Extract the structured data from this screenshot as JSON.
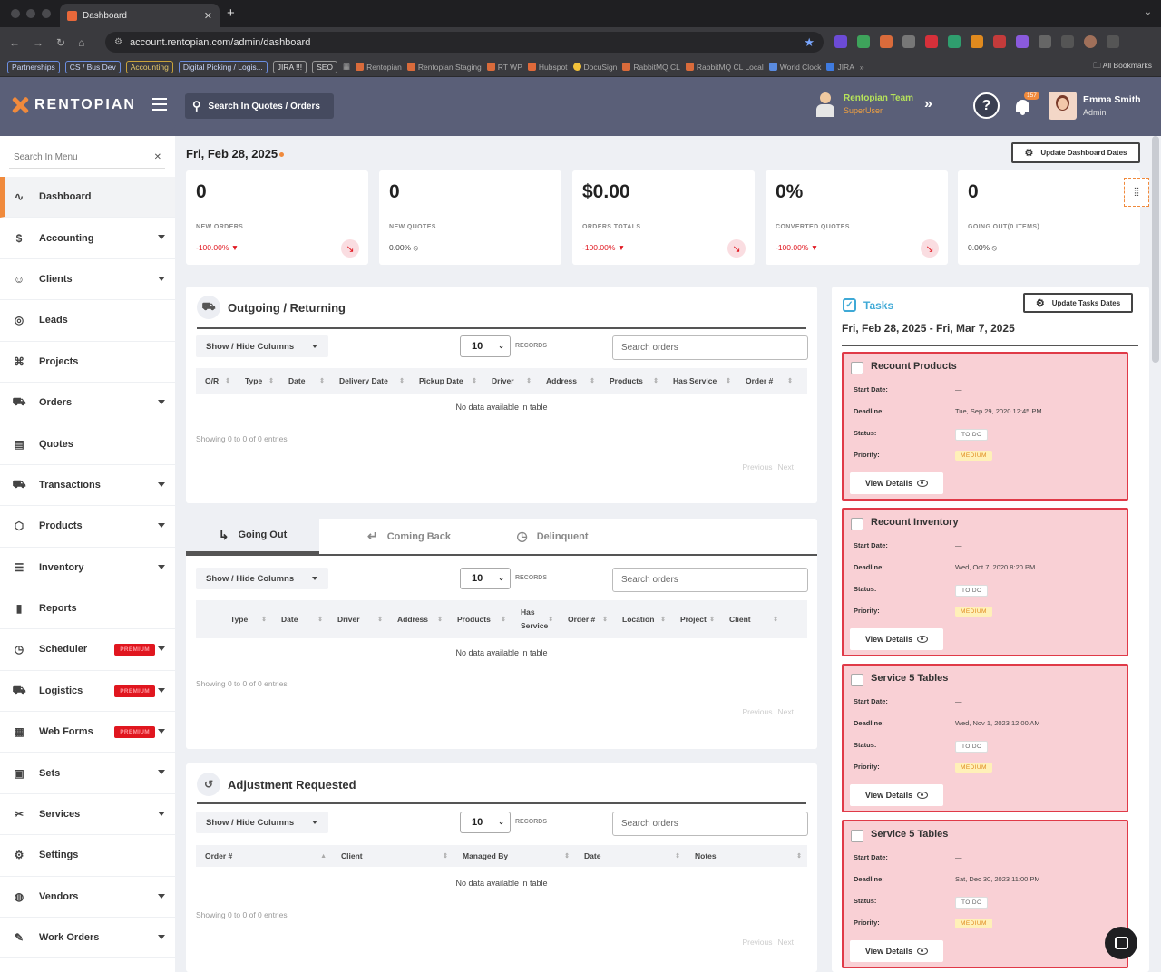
{
  "browser": {
    "tab_title": "Dashboard",
    "url": "account.rentopian.com/admin/dashboard",
    "bookmarks_chips": [
      "Partnerships",
      "CS / Bus Dev",
      "Accounting",
      "Digital Picking / Logis...",
      "JIRA !!!",
      "SEO"
    ],
    "bookmarks_links": [
      "Rentopian",
      "Rentopian Staging",
      "RT WP",
      "Hubspot",
      "DocuSign",
      "RabbitMQ CL",
      "RabbitMQ CL Local",
      "World Clock",
      "JIRA"
    ],
    "all_bookmarks": "All Bookmarks"
  },
  "header": {
    "logo": "RENTOPIAN",
    "search_label": "Search In Quotes / Orders",
    "team_name": "Rentopian Team",
    "team_role": "SuperUser",
    "help": "?",
    "notif_count": "157",
    "user_name": "Emma Smith",
    "user_role": "Admin"
  },
  "sidebar": {
    "search_placeholder": "Search In Menu",
    "premium_label": "PREMIUM",
    "items": [
      {
        "label": "Dashboard",
        "icon": "pulse-icon",
        "glyph": "∿"
      },
      {
        "label": "Accounting",
        "icon": "dollar-icon",
        "glyph": "$"
      },
      {
        "label": "Clients",
        "icon": "users-icon",
        "glyph": "☺"
      },
      {
        "label": "Leads",
        "icon": "target-icon",
        "glyph": "◎"
      },
      {
        "label": "Projects",
        "icon": "command-icon",
        "glyph": "⌘"
      },
      {
        "label": "Orders",
        "icon": "cart-icon",
        "glyph": "⛟"
      },
      {
        "label": "Quotes",
        "icon": "document-icon",
        "glyph": "▤"
      },
      {
        "label": "Transactions",
        "icon": "cart-icon",
        "glyph": "⛟"
      },
      {
        "label": "Products",
        "icon": "box-icon",
        "glyph": "⬡"
      },
      {
        "label": "Inventory",
        "icon": "database-icon",
        "glyph": "☰"
      },
      {
        "label": "Reports",
        "icon": "bar-chart-icon",
        "glyph": "▮"
      },
      {
        "label": "Scheduler",
        "icon": "clock-icon",
        "glyph": "◷"
      },
      {
        "label": "Logistics",
        "icon": "truck-icon",
        "glyph": "⛟"
      },
      {
        "label": "Web Forms",
        "icon": "table-icon",
        "glyph": "▦"
      },
      {
        "label": "Sets",
        "icon": "sets-icon",
        "glyph": "▣"
      },
      {
        "label": "Services",
        "icon": "tools-icon",
        "glyph": "✂"
      },
      {
        "label": "Settings",
        "icon": "gear-icon",
        "glyph": "⚙"
      },
      {
        "label": "Vendors",
        "icon": "globe-icon",
        "glyph": "◍"
      },
      {
        "label": "Work Orders",
        "icon": "wrench-icon",
        "glyph": "✎"
      }
    ]
  },
  "main": {
    "date": "Fri, Feb 28, 2025",
    "update_dates_btn": "Update Dashboard Dates",
    "stats": [
      {
        "value": "0",
        "label": "NEW ORDERS",
        "change": "-100.00%",
        "dir": "down"
      },
      {
        "value": "0",
        "label": "NEW QUOTES",
        "change": "0.00%",
        "dir": "none"
      },
      {
        "value": "$0.00",
        "label": "ORDERS TOTALS",
        "change": "-100.00%",
        "dir": "down"
      },
      {
        "value": "0%",
        "label": "CONVERTED QUOTES",
        "change": "-100.00%",
        "dir": "down"
      },
      {
        "value": "0",
        "label": "GOING OUT(0 ITEMS)",
        "change": "0.00%",
        "dir": "none"
      }
    ],
    "common": {
      "show_hide": "Show / Hide Columns",
      "records_value": "10",
      "records_label": "RECORDS",
      "search_placeholder": "Search orders",
      "no_data": "No data available in table",
      "showing": "Showing 0 to 0 of 0 entries",
      "previous": "Previous",
      "next": "Next"
    },
    "outgoing": {
      "title": "Outgoing / Returning",
      "columns": [
        "O/R",
        "Type",
        "Date",
        "Delivery Date",
        "Pickup Date",
        "Driver",
        "Address",
        "Products",
        "Has Service",
        "Order #"
      ]
    },
    "going": {
      "tabs": [
        "Going Out",
        "Coming Back",
        "Delinquent"
      ],
      "columns": [
        "Type",
        "Date",
        "Driver",
        "Address",
        "Products",
        "Has Service",
        "Order #",
        "Location",
        "Project",
        "Client"
      ]
    },
    "adjustment": {
      "title": "Adjustment Requested",
      "columns": [
        "Order #",
        "Client",
        "Managed By",
        "Date",
        "Notes"
      ]
    }
  },
  "tasks": {
    "title": "Tasks",
    "update_btn": "Update Tasks Dates",
    "range": "Fri, Feb 28, 2025 - Fri, Mar 7, 2025",
    "labels": {
      "start": "Start Date:",
      "deadline": "Deadline:",
      "status": "Status:",
      "priority": "Priority:",
      "view": "View Details"
    },
    "items": [
      {
        "title": "Recount Products",
        "start": "—",
        "deadline": "Tue, Sep 29, 2020 12:45 PM",
        "status": "TO DO",
        "priority": "MEDIUM"
      },
      {
        "title": "Recount Inventory",
        "start": "—",
        "deadline": "Wed, Oct 7, 2020 8:20 PM",
        "status": "TO DO",
        "priority": "MEDIUM"
      },
      {
        "title": "Service 5 Tables",
        "start": "—",
        "deadline": "Wed, Nov 1, 2023 12:00 AM",
        "status": "TO DO",
        "priority": "MEDIUM"
      },
      {
        "title": "Service 5 Tables",
        "start": "—",
        "deadline": "Sat, Dec 30, 2023 11:00 PM",
        "status": "TO DO",
        "priority": "MEDIUM"
      }
    ]
  },
  "colors": {
    "accent": "#f08a3c",
    "header_bg": "#5a5f78",
    "task_bg": "#f9d0d5",
    "task_border": "#e03a48",
    "danger": "#e0161f"
  }
}
